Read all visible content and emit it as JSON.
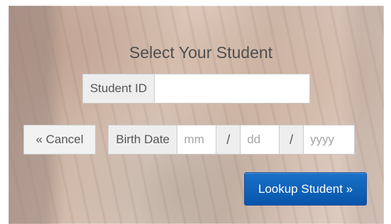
{
  "form": {
    "title": "Select Your Student",
    "student_id": {
      "label": "Student ID",
      "value": "",
      "placeholder": ""
    },
    "cancel_button": {
      "label": "« Cancel"
    },
    "birth_date": {
      "label": "Birth Date",
      "month": {
        "value": "",
        "placeholder": "mm"
      },
      "separator_1": "/",
      "day": {
        "value": "",
        "placeholder": "dd"
      },
      "separator_2": "/",
      "year": {
        "value": "",
        "placeholder": "yyyy"
      }
    },
    "lookup_button": {
      "label": "Lookup Student »"
    }
  },
  "colors": {
    "panel_overlay": "#ffffff",
    "addon_background": "#eeeeee",
    "border": "#cccccc",
    "text": "#555555",
    "primary_button": "#0b5fb8"
  }
}
